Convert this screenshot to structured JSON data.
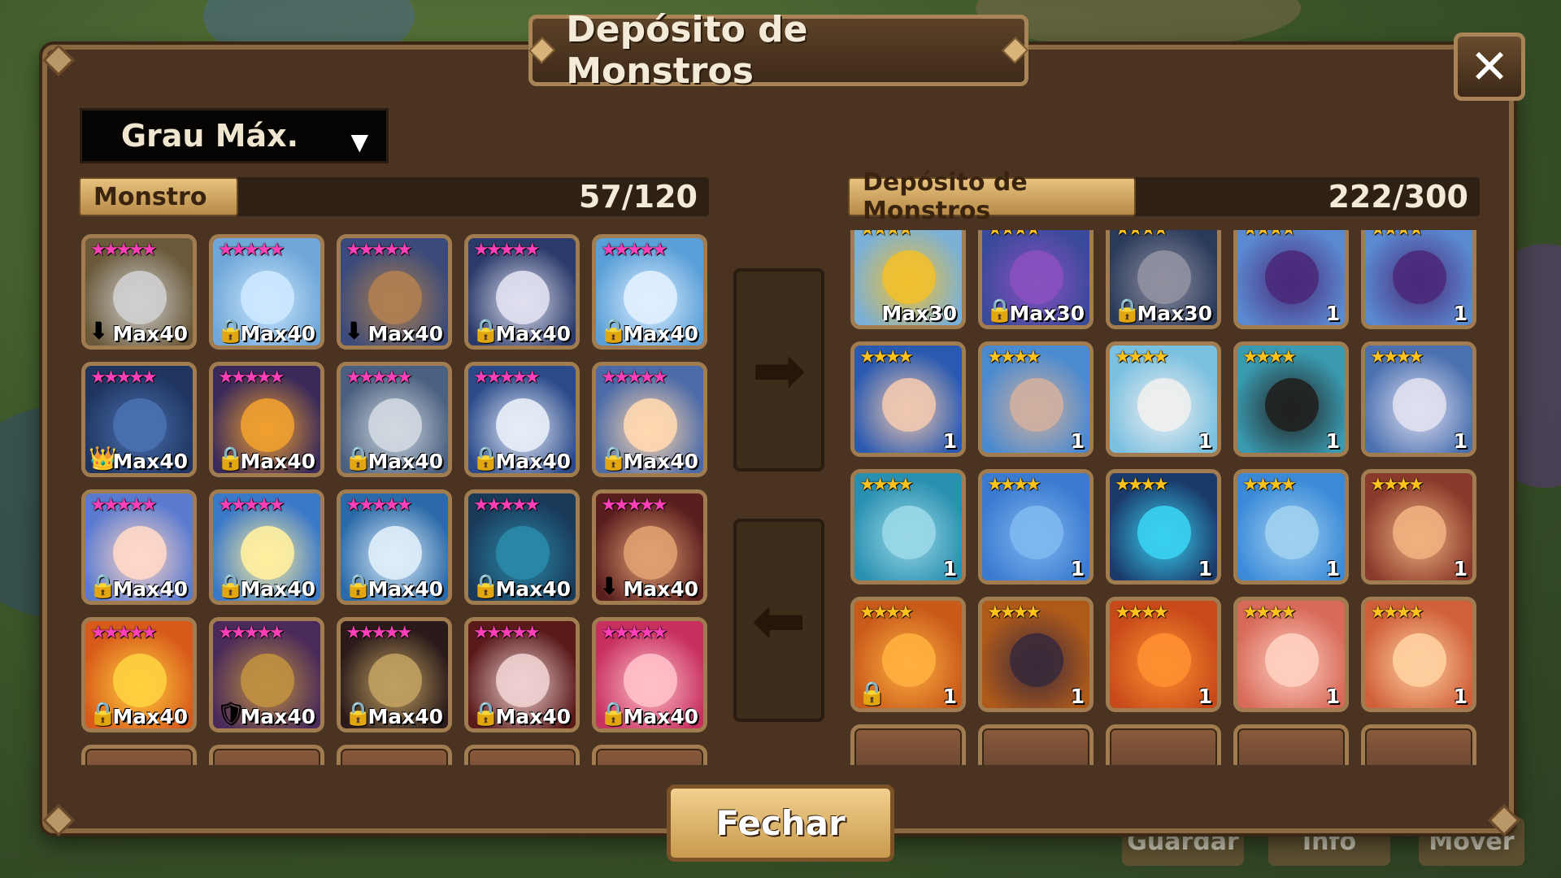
{
  "title": "Depósito de Monstros",
  "close_label": "✕",
  "filter": {
    "selected": "Grau Máx.",
    "arrow": "▼"
  },
  "left_panel": {
    "tab": "Monstro",
    "count": "57/120"
  },
  "right_panel": {
    "tab": "Depósito de Monstros",
    "count": "222/300"
  },
  "transfer_right_icon": "➡",
  "transfer_left_icon": "⬅",
  "close_button": "Fechar",
  "background_buttons": [
    "Guardar",
    "Info",
    "Mover"
  ],
  "colors": {
    "star_pink": "#ff3fb8",
    "star_gold": "#ffc21a",
    "frame": "#4a3421"
  },
  "left_cards": [
    {
      "stars": "★★★★★",
      "label": "Max40",
      "badge": "⬇",
      "badge_name": "down-arrow-icon",
      "c1": "#6b5a3a",
      "c2": "#cfcfcf"
    },
    {
      "stars": "★★★★★",
      "label": "Max40",
      "badge": "🔒",
      "badge_name": "lock-icon",
      "c1": "#6fa7d8",
      "c2": "#cde8ff"
    },
    {
      "stars": "★★★★★",
      "label": "Max40",
      "badge": "⬇",
      "badge_name": "down-arrow-icon",
      "c1": "#3a4a7a",
      "c2": "#b08050"
    },
    {
      "stars": "★★★★★",
      "label": "Max40",
      "badge": "🔒",
      "badge_name": "lock-icon",
      "c1": "#2a3a6a",
      "c2": "#e0e0f0"
    },
    {
      "stars": "★★★★★",
      "label": "Max40",
      "badge": "🔒",
      "badge_name": "lock-icon",
      "c1": "#5aa0d8",
      "c2": "#e0f0ff"
    },
    {
      "stars": "★★★★★",
      "label": "Max40",
      "badge": "👑",
      "badge_name": "crown-icon",
      "c1": "#1f3560",
      "c2": "#4a70b0"
    },
    {
      "stars": "★★★★★",
      "label": "Max40",
      "badge": "🔒",
      "badge_name": "lock-icon",
      "c1": "#3a2a5a",
      "c2": "#f0a030"
    },
    {
      "stars": "★★★★★",
      "label": "Max40",
      "badge": "🔒",
      "badge_name": "lock-icon",
      "c1": "#4a6080",
      "c2": "#d0d8e0"
    },
    {
      "stars": "★★★★★",
      "label": "Max40",
      "badge": "🔒",
      "badge_name": "lock-icon",
      "c1": "#2a4a8a",
      "c2": "#e8eef8"
    },
    {
      "stars": "★★★★★",
      "label": "Max40",
      "badge": "🔒",
      "badge_name": "lock-icon",
      "c1": "#4a6aa8",
      "c2": "#ffd8b0"
    },
    {
      "stars": "★★★★★",
      "label": "Max40",
      "badge": "🔒",
      "badge_name": "lock-icon",
      "c1": "#5a7ad0",
      "c2": "#ffd8c8"
    },
    {
      "stars": "★★★★★",
      "label": "Max40",
      "badge": "🔒",
      "badge_name": "lock-icon",
      "c1": "#3a78c8",
      "c2": "#fff0a0"
    },
    {
      "stars": "★★★★★",
      "label": "Max40",
      "badge": "🔒",
      "badge_name": "lock-icon",
      "c1": "#2a6aa8",
      "c2": "#dfeefa"
    },
    {
      "stars": "★★★★★",
      "label": "Max40",
      "badge": "🔒",
      "badge_name": "lock-icon",
      "c1": "#1a3a5a",
      "c2": "#2a8aa8"
    },
    {
      "stars": "★★★★★",
      "label": "Max40",
      "badge": "⬇",
      "badge_name": "down-arrow-icon",
      "c1": "#5a1e1e",
      "c2": "#e0a070"
    },
    {
      "stars": "★★★★★",
      "label": "Max40",
      "badge": "🔒",
      "badge_name": "lock-icon",
      "c1": "#d85a1a",
      "c2": "#ffd040"
    },
    {
      "stars": "★★★★★",
      "label": "Max40",
      "badge": "🛡",
      "badge_name": "shield-icon",
      "c1": "#4a2a5a",
      "c2": "#c09040"
    },
    {
      "stars": "★★★★★",
      "label": "Max40",
      "badge": "🔒",
      "badge_name": "lock-icon",
      "c1": "#2a1a1a",
      "c2": "#c0a060"
    },
    {
      "stars": "★★★★★",
      "label": "Max40",
      "badge": "🔒",
      "badge_name": "lock-icon",
      "c1": "#5a1a1a",
      "c2": "#f0d0d0"
    },
    {
      "stars": "★★★★★",
      "label": "Max40",
      "badge": "🔒",
      "badge_name": "lock-icon",
      "c1": "#c83060",
      "c2": "#ffc0c8"
    }
  ],
  "right_cards": [
    {
      "stars": "★★★★",
      "label": "Max30",
      "badge": "",
      "badge_name": "",
      "c1": "#7ab0d8",
      "c2": "#f0c030"
    },
    {
      "stars": "★★★★",
      "label": "Max30",
      "badge": "🔒",
      "badge_name": "lock-icon",
      "c1": "#3a4a9a",
      "c2": "#8a50c0"
    },
    {
      "stars": "★★★★",
      "label": "Max30",
      "badge": "🔒",
      "badge_name": "lock-icon",
      "c1": "#2a3a5a",
      "c2": "#9090a0"
    },
    {
      "stars": "★★★★",
      "label": "1",
      "badge": "",
      "badge_name": "",
      "c1": "#5a8ad0",
      "c2": "#4a2a7a"
    },
    {
      "stars": "★★★★",
      "label": "1",
      "badge": "",
      "badge_name": "",
      "c1": "#5a8ad0",
      "c2": "#4a2a7a"
    },
    {
      "stars": "★★★★",
      "label": "1",
      "badge": "",
      "badge_name": "",
      "c1": "#2a5ab0",
      "c2": "#f0c8b0"
    },
    {
      "stars": "★★★★",
      "label": "1",
      "badge": "",
      "badge_name": "",
      "c1": "#4a8ad0",
      "c2": "#d0b0a0"
    },
    {
      "stars": "★★★★",
      "label": "1",
      "badge": "",
      "badge_name": "",
      "c1": "#7ac0e0",
      "c2": "#f0f0f0"
    },
    {
      "stars": "★★★★",
      "label": "1",
      "badge": "",
      "badge_name": "",
      "c1": "#3a9ab0",
      "c2": "#202020"
    },
    {
      "stars": "★★★★",
      "label": "1",
      "badge": "",
      "badge_name": "",
      "c1": "#4a70b0",
      "c2": "#e0e0f0"
    },
    {
      "stars": "★★★★",
      "label": "1",
      "badge": "",
      "badge_name": "",
      "c1": "#2a90b0",
      "c2": "#9ad8e8"
    },
    {
      "stars": "★★★★",
      "label": "1",
      "badge": "",
      "badge_name": "",
      "c1": "#3a7ad0",
      "c2": "#80b8f0"
    },
    {
      "stars": "★★★★",
      "label": "1",
      "badge": "",
      "badge_name": "",
      "c1": "#1a3a6a",
      "c2": "#3ad0f0"
    },
    {
      "stars": "★★★★",
      "label": "1",
      "badge": "",
      "badge_name": "",
      "c1": "#3a8ad8",
      "c2": "#a0d0f0"
    },
    {
      "stars": "★★★★",
      "label": "1",
      "badge": "",
      "badge_name": "",
      "c1": "#8a3a2a",
      "c2": "#f0b080"
    },
    {
      "stars": "★★★★",
      "label": "1",
      "badge": "🔒",
      "badge_name": "lock-icon",
      "c1": "#c85a1a",
      "c2": "#ffb040"
    },
    {
      "stars": "★★★★",
      "label": "1",
      "badge": "",
      "badge_name": "",
      "c1": "#b05a1a",
      "c2": "#3a2a3a"
    },
    {
      "stars": "★★★★",
      "label": "1",
      "badge": "",
      "badge_name": "",
      "c1": "#c84a1a",
      "c2": "#ff9030"
    },
    {
      "stars": "★★★★",
      "label": "1",
      "badge": "",
      "badge_name": "",
      "c1": "#d86a5a",
      "c2": "#ffd0c0"
    },
    {
      "stars": "★★★★",
      "label": "1",
      "badge": "",
      "badge_name": "",
      "c1": "#d0603a",
      "c2": "#ffd0a0"
    }
  ]
}
